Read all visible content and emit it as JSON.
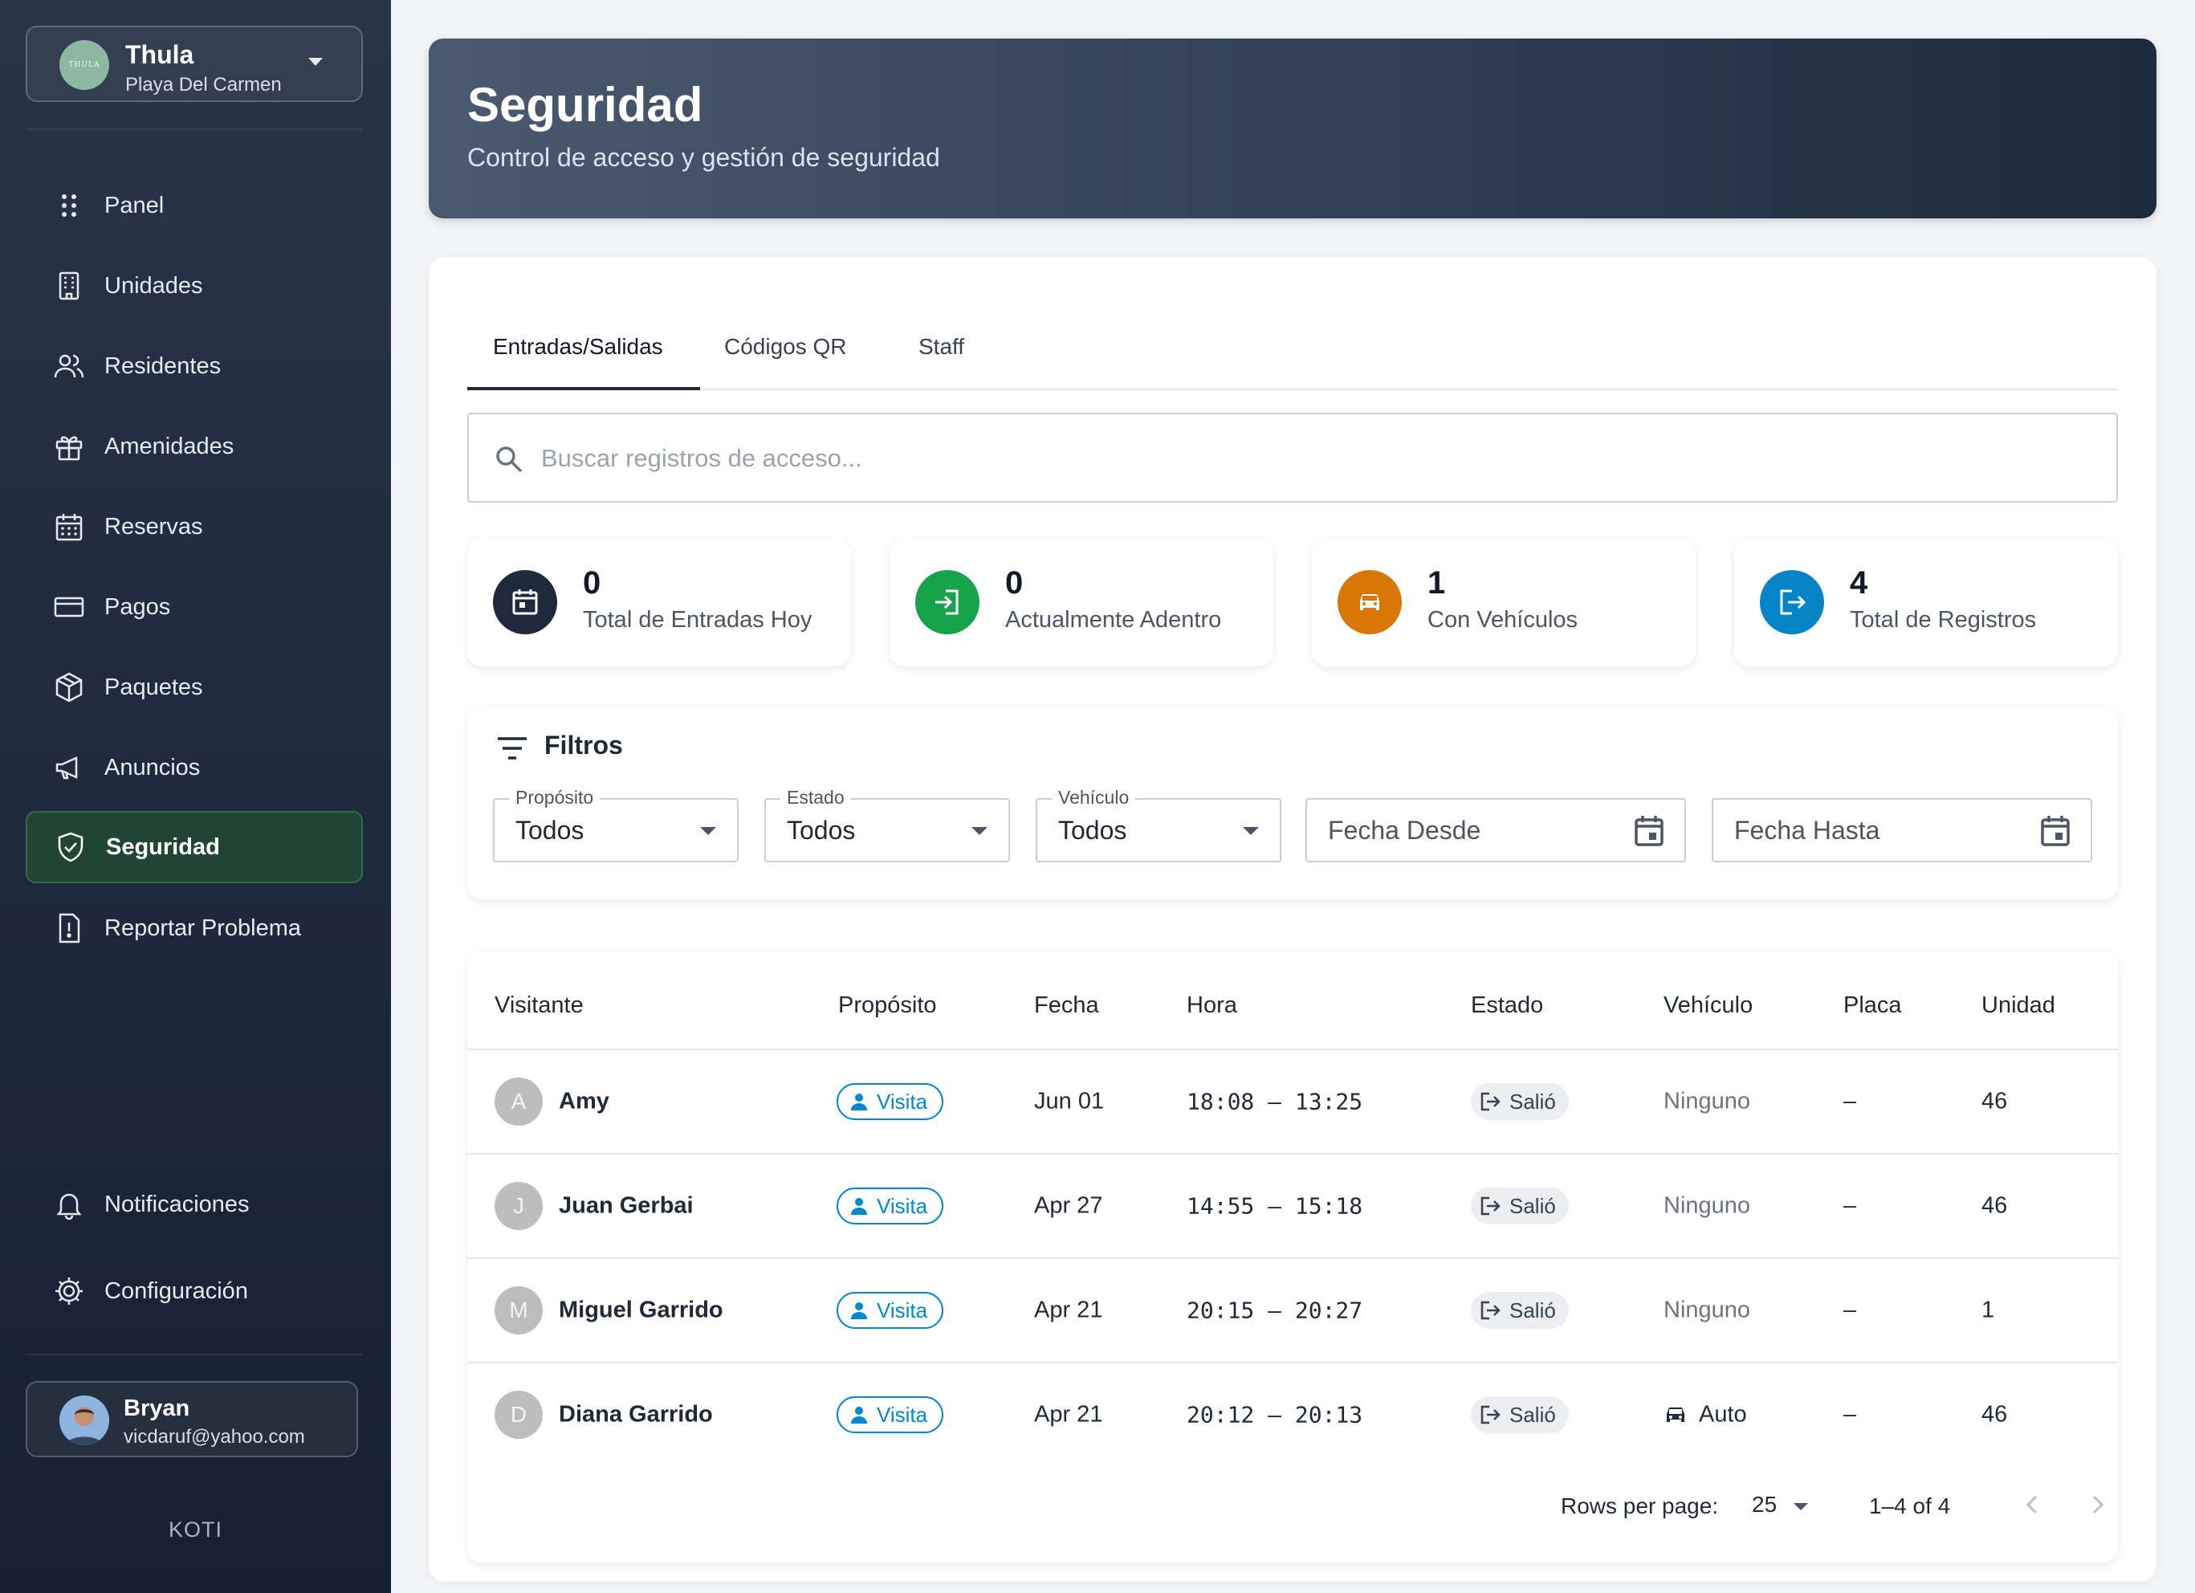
{
  "sidebar": {
    "org": {
      "name": "Thula",
      "location": "Playa Del Carmen",
      "logo_text": "THULA"
    },
    "items": [
      {
        "label": "Panel",
        "icon": "grid-dots-icon"
      },
      {
        "label": "Unidades",
        "icon": "building-icon"
      },
      {
        "label": "Residentes",
        "icon": "people-icon"
      },
      {
        "label": "Amenidades",
        "icon": "gift-icon"
      },
      {
        "label": "Reservas",
        "icon": "calendar-icon"
      },
      {
        "label": "Pagos",
        "icon": "card-icon"
      },
      {
        "label": "Paquetes",
        "icon": "package-icon"
      },
      {
        "label": "Anuncios",
        "icon": "megaphone-icon"
      },
      {
        "label": "Seguridad",
        "icon": "shield-icon",
        "active": true
      },
      {
        "label": "Reportar Problema",
        "icon": "report-icon"
      }
    ],
    "bottom_items": [
      {
        "label": "Notificaciones",
        "icon": "bell-icon"
      },
      {
        "label": "Configuración",
        "icon": "gear-icon"
      }
    ],
    "user": {
      "name": "Bryan",
      "email": "vicdaruf@yahoo.com"
    },
    "brand": "KOTI"
  },
  "header": {
    "title": "Seguridad",
    "subtitle": "Control de acceso y gestión de seguridad"
  },
  "tabs": [
    "Entradas/Salidas",
    "Códigos QR",
    "Staff"
  ],
  "search": {
    "placeholder": "Buscar registros de acceso..."
  },
  "stats": [
    {
      "value": "0",
      "label": "Total de Entradas Hoy",
      "color": "#1e293b",
      "icon": "calendar-icon"
    },
    {
      "value": "0",
      "label": "Actualmente Adentro",
      "color": "#16a34a",
      "icon": "login-icon"
    },
    {
      "value": "1",
      "label": "Con Vehículos",
      "color": "#d97706",
      "icon": "car-icon"
    },
    {
      "value": "4",
      "label": "Total de Registros",
      "color": "#0284c7",
      "icon": "logout-icon"
    }
  ],
  "filters": {
    "title": "Filtros",
    "purpose": {
      "label": "Propósito",
      "value": "Todos"
    },
    "state": {
      "label": "Estado",
      "value": "Todos"
    },
    "vehicle": {
      "label": "Vehículo",
      "value": "Todos"
    },
    "date_from": "Fecha Desde",
    "date_to": "Fecha Hasta"
  },
  "table": {
    "headers": [
      "Visitante",
      "Propósito",
      "Fecha",
      "Hora",
      "Estado",
      "Vehículo",
      "Placa",
      "Unidad"
    ],
    "rows": [
      {
        "initial": "A",
        "visitor": "Amy",
        "purpose": "Visita",
        "date": "Jun 01",
        "time": "18:08 – 13:25",
        "state": "Salió",
        "vehicle": "Ninguno",
        "plate": "–",
        "unit": "46"
      },
      {
        "initial": "J",
        "visitor": "Juan Gerbai",
        "purpose": "Visita",
        "date": "Apr 27",
        "time": "14:55 – 15:18",
        "state": "Salió",
        "vehicle": "Ninguno",
        "plate": "–",
        "unit": "46"
      },
      {
        "initial": "M",
        "visitor": "Miguel Garrido",
        "purpose": "Visita",
        "date": "Apr 21",
        "time": "20:15 – 20:27",
        "state": "Salió",
        "vehicle": "Ninguno",
        "plate": "–",
        "unit": "1"
      },
      {
        "initial": "D",
        "visitor": "Diana Garrido",
        "purpose": "Visita",
        "date": "Apr 21",
        "time": "20:12 – 20:13",
        "state": "Salió",
        "vehicle": "Auto",
        "plate": "–",
        "unit": "46"
      }
    ],
    "pagination": {
      "rows_per_page_label": "Rows per page:",
      "rows_per_page": "25",
      "range": "1–4 of 4"
    }
  }
}
